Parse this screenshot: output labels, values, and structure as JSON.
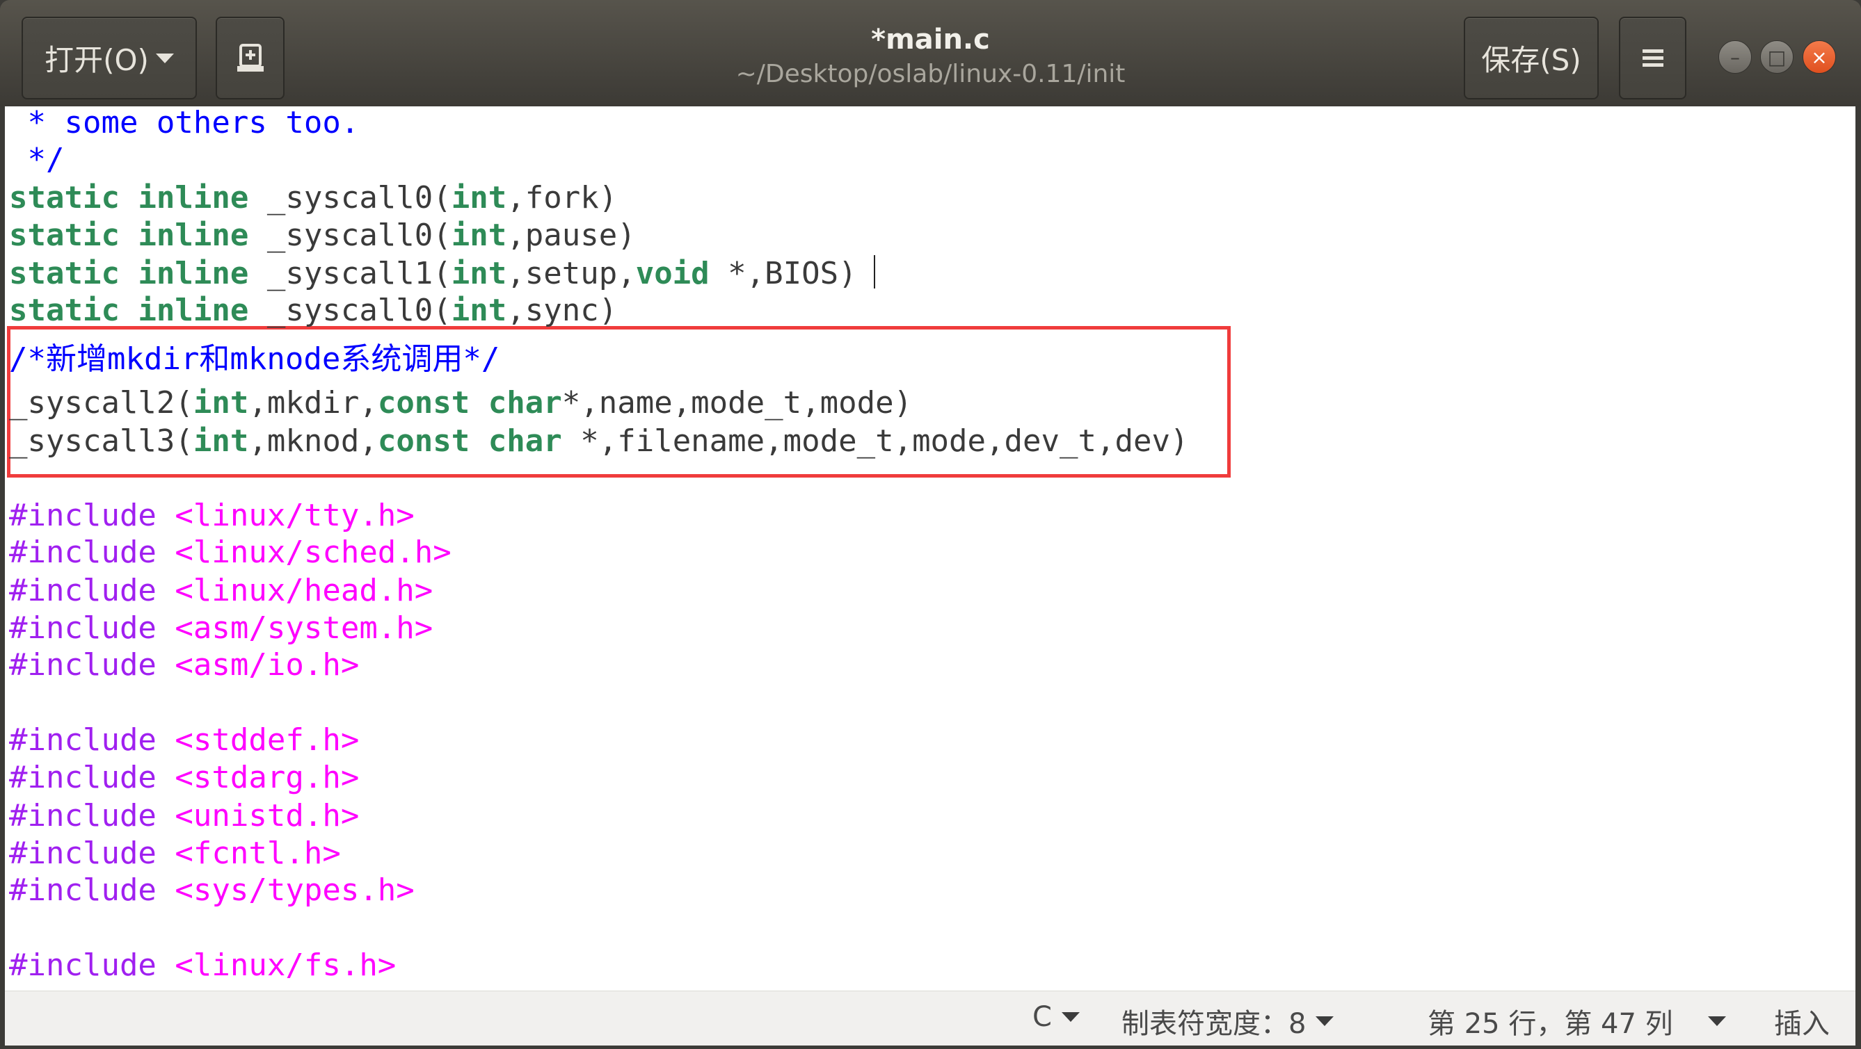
{
  "header": {
    "open_label": "打开(O)",
    "open_icon": "chevron-down-icon",
    "new_tab_icon": "new-document-icon",
    "title": "*main.c",
    "subtitle": "~/Desktop/oslab/linux-0.11/init",
    "save_label": "保存(S)",
    "menu_icon": "hamburger-icon",
    "window_controls": {
      "minimize": "–",
      "maximize": "□",
      "close": "×"
    }
  },
  "colors": {
    "keyword": "#2e8b57",
    "comment": "#0000ff",
    "preprocessor": "#a020f0",
    "string": "#ff00ff",
    "highlight_box": "#f03c3c"
  },
  "code": {
    "lines": [
      [
        {
          "t": " * some others too.",
          "c": "cm"
        }
      ],
      [
        {
          "t": " */",
          "c": "cm"
        }
      ],
      [
        {
          "t": "static inline",
          "c": "kw"
        },
        {
          "t": " _syscall0(",
          "c": ""
        },
        {
          "t": "int",
          "c": "kw"
        },
        {
          "t": ",fork)",
          "c": ""
        }
      ],
      [
        {
          "t": "static inline",
          "c": "kw"
        },
        {
          "t": " _syscall0(",
          "c": ""
        },
        {
          "t": "int",
          "c": "kw"
        },
        {
          "t": ",pause)",
          "c": ""
        }
      ],
      [
        {
          "t": "static inline",
          "c": "kw"
        },
        {
          "t": " _syscall1(",
          "c": ""
        },
        {
          "t": "int",
          "c": "kw"
        },
        {
          "t": ",setup,",
          "c": ""
        },
        {
          "t": "void",
          "c": "kw"
        },
        {
          "t": " *,BIOS)",
          "c": ""
        }
      ],
      [
        {
          "t": "static inline",
          "c": "kw"
        },
        {
          "t": " _syscall0(",
          "c": ""
        },
        {
          "t": "int",
          "c": "kw"
        },
        {
          "t": ",sync)",
          "c": ""
        }
      ],
      [
        {
          "t": "/*新增mkdir和mknode系统调用*/",
          "c": "cm"
        }
      ],
      [
        {
          "t": "_syscall2(",
          "c": ""
        },
        {
          "t": "int",
          "c": "kw"
        },
        {
          "t": ",mkdir,",
          "c": ""
        },
        {
          "t": "const",
          "c": "kw"
        },
        {
          "t": " ",
          "c": ""
        },
        {
          "t": "char",
          "c": "kw"
        },
        {
          "t": "*,name,mode_t,mode)",
          "c": ""
        }
      ],
      [
        {
          "t": "_syscall3(",
          "c": ""
        },
        {
          "t": "int",
          "c": "kw"
        },
        {
          "t": ",mknod,",
          "c": ""
        },
        {
          "t": "const",
          "c": "kw"
        },
        {
          "t": " ",
          "c": ""
        },
        {
          "t": "char",
          "c": "kw"
        },
        {
          "t": " *,filename,mode_t,mode,dev_t,dev)",
          "c": ""
        }
      ],
      [
        {
          "t": "#include",
          "c": "pp"
        },
        {
          "t": " <linux/tty.h>",
          "c": "st"
        }
      ],
      [
        {
          "t": "#include",
          "c": "pp"
        },
        {
          "t": " <linux/sched.h>",
          "c": "st"
        }
      ],
      [
        {
          "t": "#include",
          "c": "pp"
        },
        {
          "t": " <linux/head.h>",
          "c": "st"
        }
      ],
      [
        {
          "t": "#include",
          "c": "pp"
        },
        {
          "t": " <asm/system.h>",
          "c": "st"
        }
      ],
      [
        {
          "t": "#include",
          "c": "pp"
        },
        {
          "t": " <asm/io.h>",
          "c": "st"
        }
      ],
      [
        {
          "t": "#include",
          "c": "pp"
        },
        {
          "t": " <stddef.h>",
          "c": "st"
        }
      ],
      [
        {
          "t": "#include",
          "c": "pp"
        },
        {
          "t": " <stdarg.h>",
          "c": "st"
        }
      ],
      [
        {
          "t": "#include",
          "c": "pp"
        },
        {
          "t": " <unistd.h>",
          "c": "st"
        }
      ],
      [
        {
          "t": "#include",
          "c": "pp"
        },
        {
          "t": " <fcntl.h>",
          "c": "st"
        }
      ],
      [
        {
          "t": "#include",
          "c": "pp"
        },
        {
          "t": " <sys/types.h>",
          "c": "st"
        }
      ],
      [
        {
          "t": "#include",
          "c": "pp"
        },
        {
          "t": " <linux/fs.h>",
          "c": "st"
        }
      ]
    ]
  },
  "status": {
    "language": "C",
    "tab_width": "制表符宽度：8",
    "position": "第 25 行，第 47 列",
    "mode": "插入"
  }
}
